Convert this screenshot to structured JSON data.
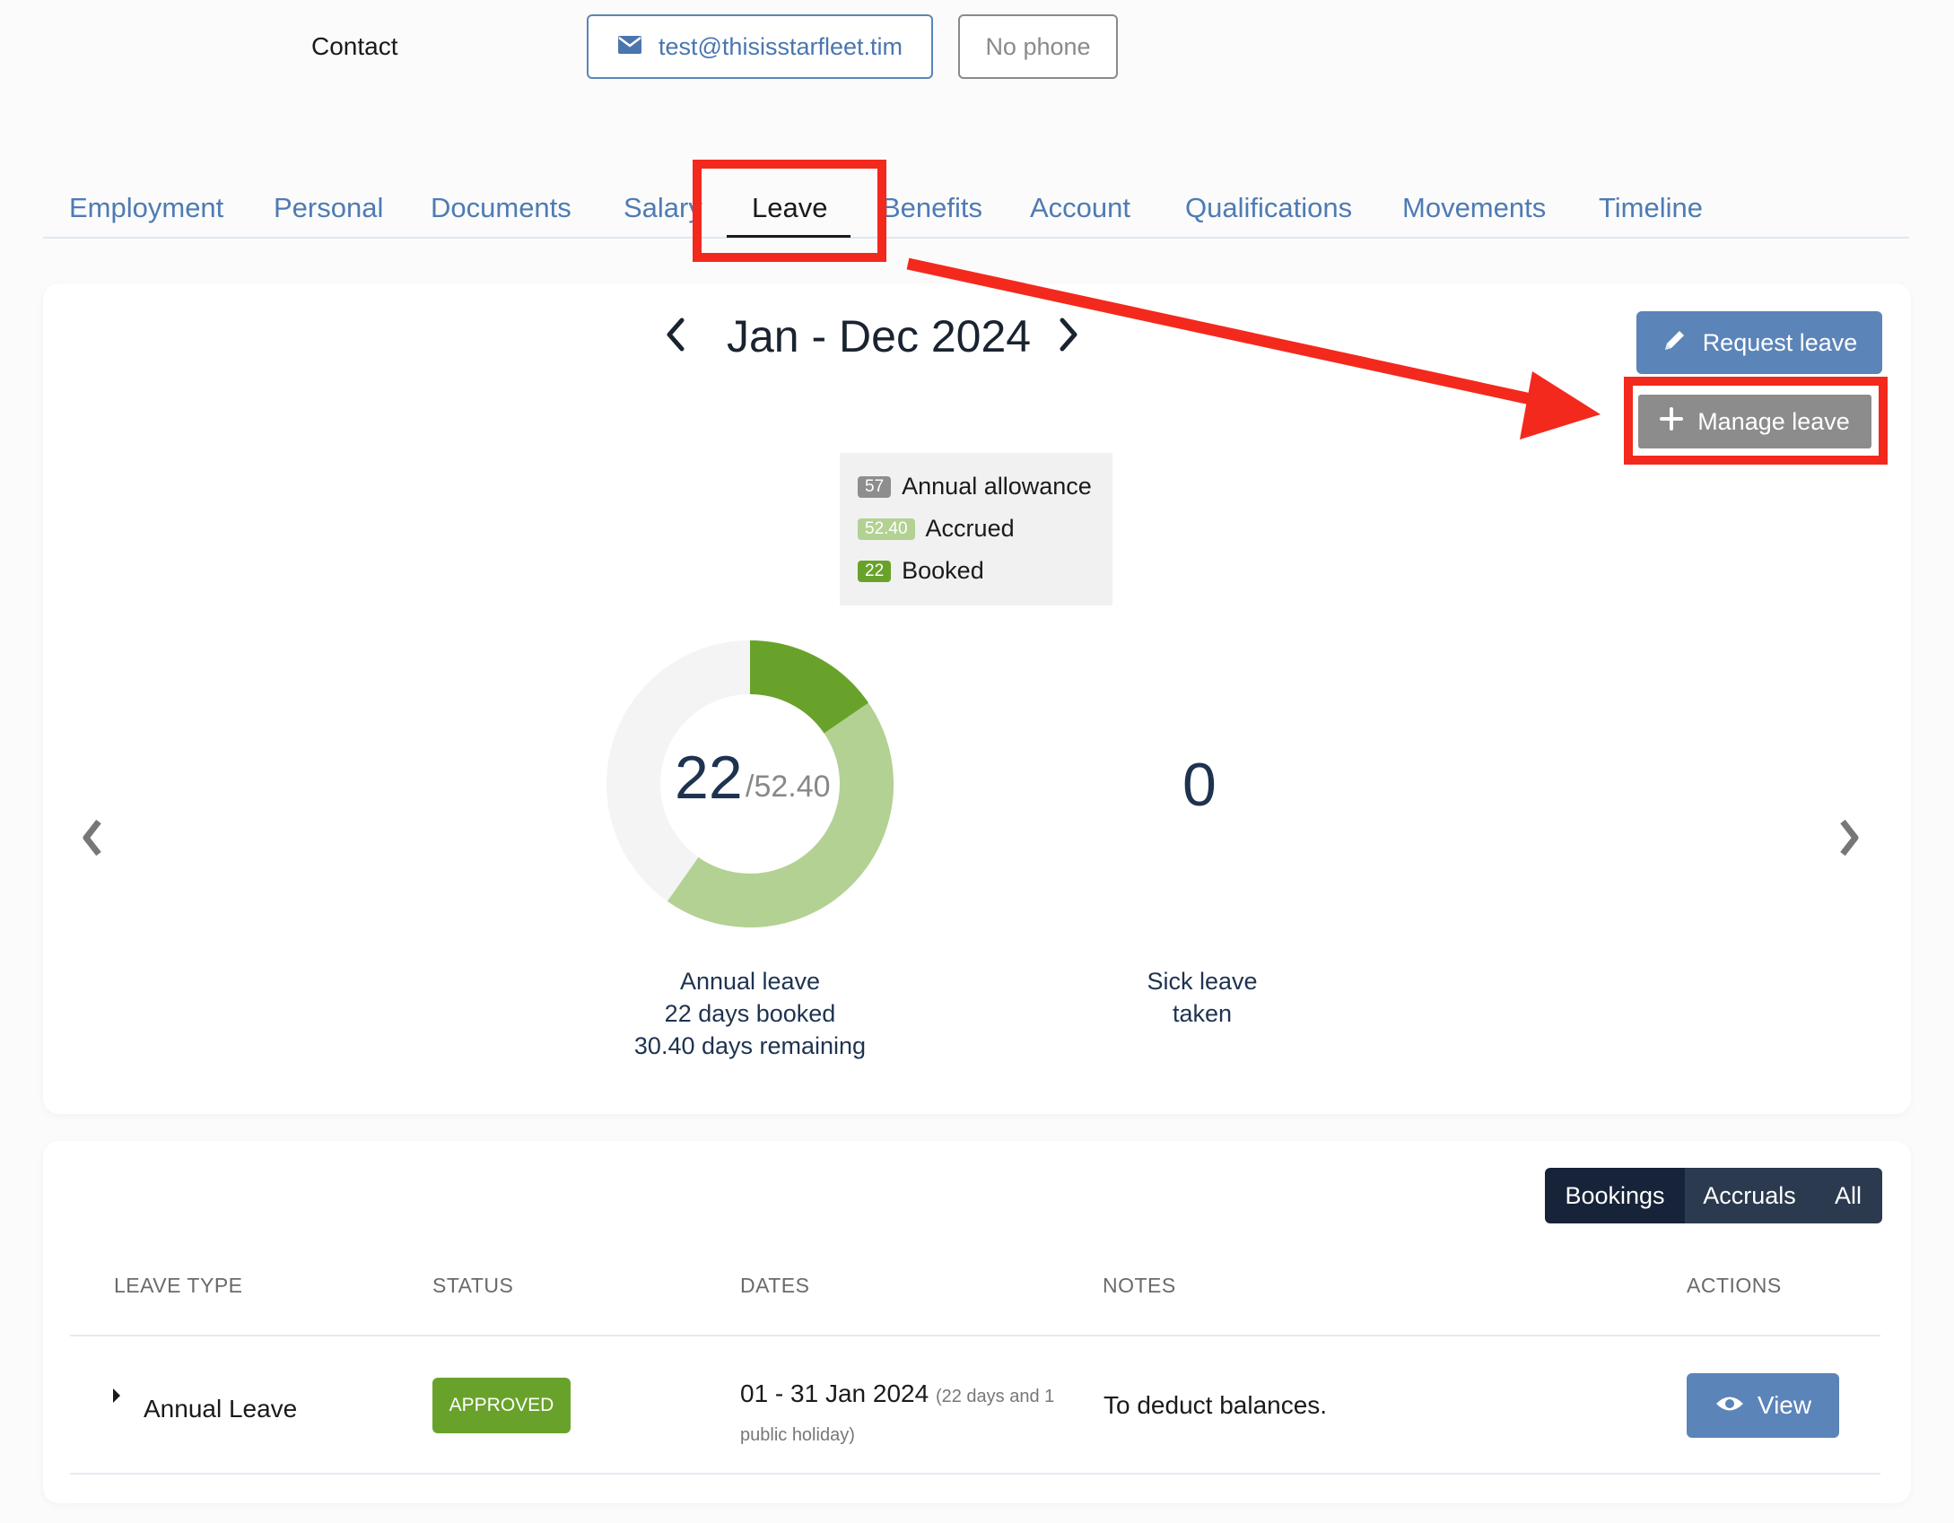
{
  "contact": {
    "label": "Contact",
    "email": "test@thisisstarfleet.tim",
    "phone": "No phone",
    "email_icon": "envelope-icon"
  },
  "tabs": [
    {
      "label": "Employment"
    },
    {
      "label": "Personal"
    },
    {
      "label": "Documents"
    },
    {
      "label": "Salary"
    },
    {
      "label": "Leave",
      "active": true
    },
    {
      "label": "Benefits"
    },
    {
      "label": "Account"
    },
    {
      "label": "Qualifications"
    },
    {
      "label": "Movements"
    },
    {
      "label": "Timeline"
    }
  ],
  "period": {
    "label": "Jan - Dec 2024",
    "prev_icon": "chevron-left-icon",
    "next_icon": "chevron-right-icon"
  },
  "actions": {
    "request_leave": "Request leave",
    "request_icon": "pencil-icon",
    "manage_leave": "Manage leave",
    "manage_icon": "plus-icon"
  },
  "legend": [
    {
      "value": "57",
      "label": "Annual allowance",
      "color": "#8e8e8e"
    },
    {
      "value": "52.40",
      "label": "Accrued",
      "color": "#b2d193"
    },
    {
      "value": "22",
      "label": "Booked",
      "color": "#69a22a"
    }
  ],
  "annual": {
    "booked": "22",
    "accrued": "/52.40",
    "allowance_value": 57,
    "accrued_value": 52.4,
    "booked_value": 22,
    "title": "Annual leave",
    "line2": "22 days booked",
    "line3": "30.40 days remaining"
  },
  "sick": {
    "value": "0",
    "line1": "Sick leave",
    "line2": "taken"
  },
  "carousel": {
    "prev_icon": "chevron-left-icon",
    "next_icon": "chevron-right-icon"
  },
  "filter": {
    "bookings": "Bookings",
    "accruals": "Accruals",
    "all": "All"
  },
  "table": {
    "headers": {
      "type": "LEAVE TYPE",
      "status": "STATUS",
      "dates": "DATES",
      "notes": "NOTES",
      "actions": "ACTIONS"
    },
    "rows": [
      {
        "type": "Annual Leave",
        "status": "APPROVED",
        "dates": "01 - 31 Jan 2024",
        "dates_note": "(22 days and 1 public holiday)",
        "notes": "To deduct balances.",
        "action": "View",
        "action_icon": "eye-icon"
      }
    ]
  },
  "colors": {
    "accent": "#5b84b8",
    "approved": "#69a22a",
    "annotation": "#f3291d"
  }
}
